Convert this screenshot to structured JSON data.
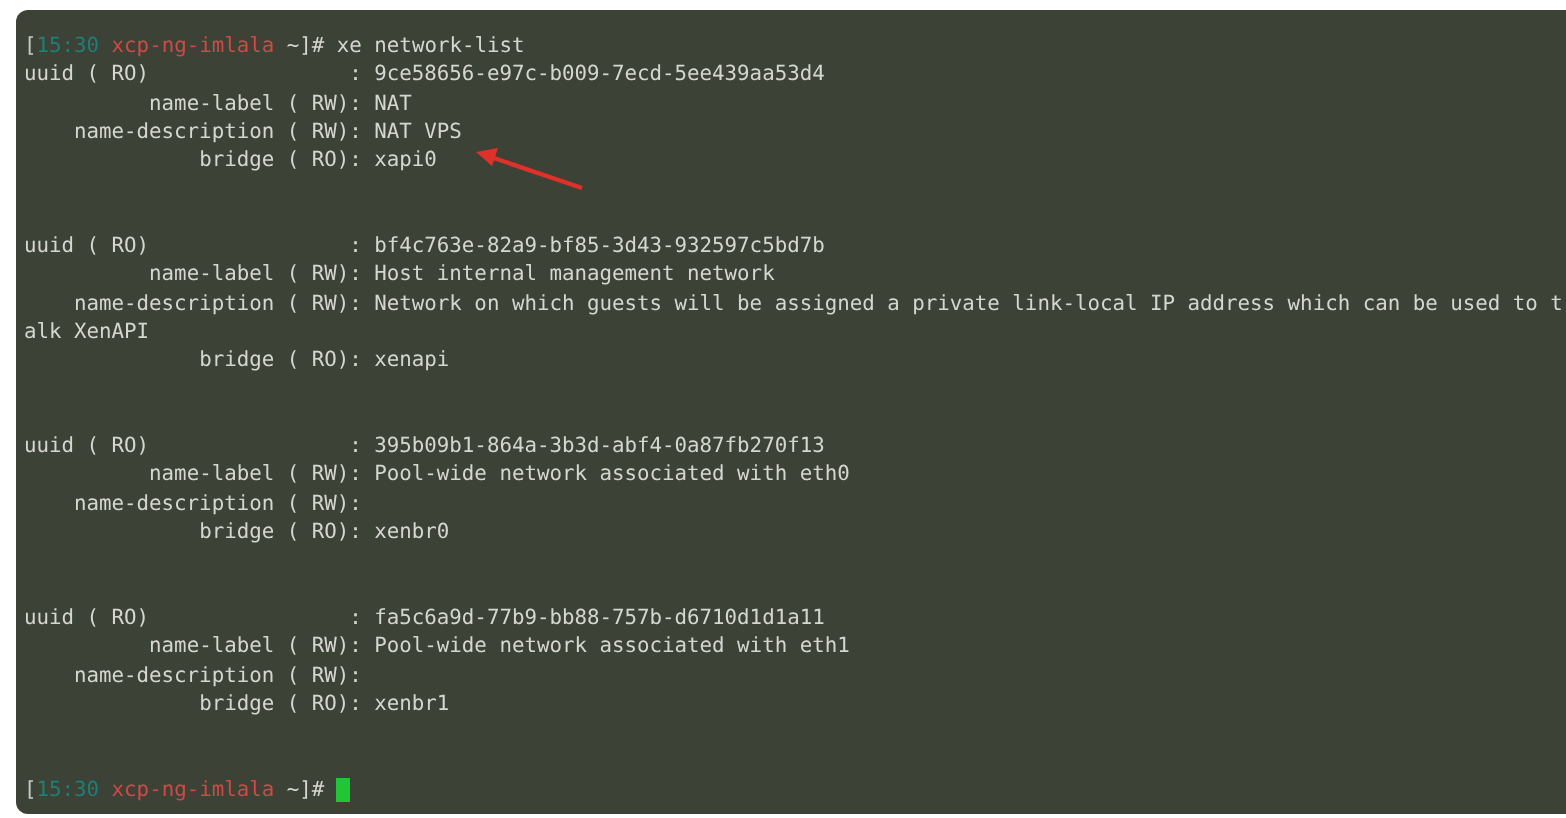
{
  "prompt": {
    "open": "[",
    "time": "15:30",
    "host": "xcp-ng-imlala",
    "tail": "~]#",
    "command": "xe network-list"
  },
  "records": [
    {
      "fields": [
        {
          "label": "uuid ( RO)",
          "colon": ":",
          "value": "9ce58656-e97c-b009-7ecd-5ee439aa53d4"
        },
        {
          "label": "name-label ( RW)",
          "colon": ":",
          "value": "NAT"
        },
        {
          "label": "name-description ( RW)",
          "colon": ":",
          "value": "NAT VPS"
        },
        {
          "label": "bridge ( RO)",
          "colon": ":",
          "value": "xapi0"
        }
      ]
    },
    {
      "fields": [
        {
          "label": "uuid ( RO)",
          "colon": ":",
          "value": "bf4c763e-82a9-bf85-3d43-932597c5bd7b"
        },
        {
          "label": "name-label ( RW)",
          "colon": ":",
          "value": "Host internal management network"
        },
        {
          "label": "name-description ( RW)",
          "colon": ":",
          "value": "Network on which guests will be assigned a private link-local IP address which can be used to t",
          "wrap": "alk XenAPI"
        },
        {
          "label": "bridge ( RO)",
          "colon": ":",
          "value": "xenapi"
        }
      ]
    },
    {
      "fields": [
        {
          "label": "uuid ( RO)",
          "colon": ":",
          "value": "395b09b1-864a-3b3d-abf4-0a87fb270f13"
        },
        {
          "label": "name-label ( RW)",
          "colon": ":",
          "value": "Pool-wide network associated with eth0"
        },
        {
          "label": "name-description ( RW)",
          "colon": ":"
        },
        {
          "label": "bridge ( RO)",
          "colon": ":",
          "value": "xenbr0"
        }
      ]
    },
    {
      "fields": [
        {
          "label": "uuid ( RO)",
          "colon": ":",
          "value": "fa5c6a9d-77b9-bb88-757b-d6710d1d1a11"
        },
        {
          "label": "name-label ( RW)",
          "colon": ":",
          "value": "Pool-wide network associated with eth1"
        },
        {
          "label": "name-description ( RW)",
          "colon": ":"
        },
        {
          "label": "bridge ( RO)",
          "colon": ":",
          "value": "xenbr1"
        }
      ]
    }
  ],
  "final_prompt": {
    "open": "[",
    "time": "15:30",
    "host": "xcp-ng-imlala",
    "tail": "~]#"
  }
}
